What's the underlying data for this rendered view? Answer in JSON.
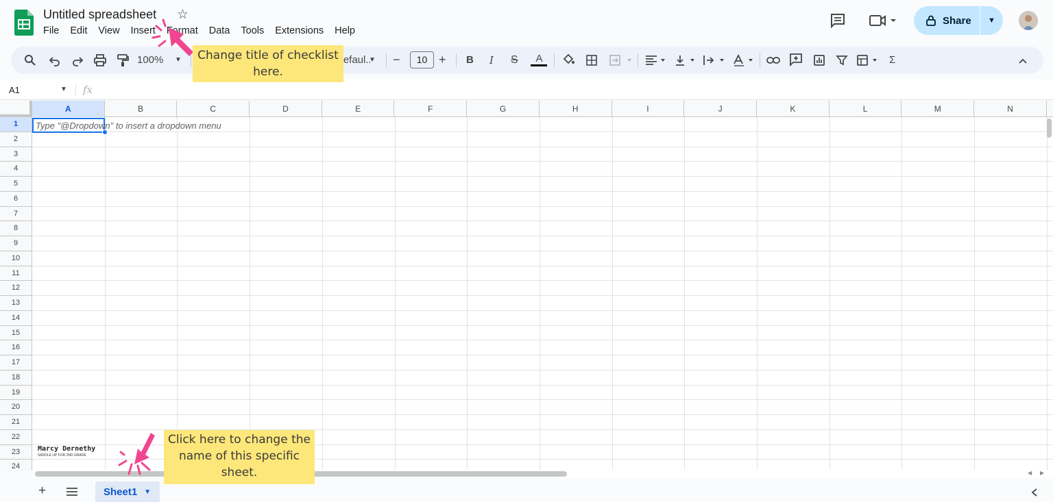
{
  "app": {
    "title": "Untitled spreadsheet",
    "menu": [
      "File",
      "Edit",
      "View",
      "Insert",
      "Format",
      "Data",
      "Tools",
      "Extensions",
      "Help"
    ],
    "share_label": "Share"
  },
  "toolbar": {
    "zoom": "100%",
    "font": "Defaul...",
    "font_size": "10",
    "bold": "B",
    "italic": "I",
    "text_color_letter": "A",
    "sum": "Σ"
  },
  "formula_bar": {
    "name_box": "A1",
    "fx_label": "fx"
  },
  "grid": {
    "columns": [
      "A",
      "B",
      "C",
      "D",
      "E",
      "F",
      "G",
      "H",
      "I",
      "J",
      "K",
      "L",
      "M",
      "N"
    ],
    "rows": [
      "1",
      "2",
      "3",
      "4",
      "5",
      "6",
      "7",
      "8",
      "9",
      "10",
      "11",
      "12",
      "13",
      "14",
      "15",
      "16",
      "17",
      "18",
      "19",
      "20",
      "21",
      "22",
      "23",
      "24"
    ],
    "selected_cell": "A1",
    "cell_hint": "Type \"@Dropdown\"  to insert a dropdown menu"
  },
  "sheets": {
    "tabs": [
      "Sheet1"
    ]
  },
  "annotations": {
    "title_callout": "Change title of checklist here.",
    "sheet_callout": "Click here to change the name of this specific sheet.",
    "watermark_line1": "Marcy Dernethy",
    "watermark_line2": "SADDLE UP FOR 2ND GRADE"
  },
  "colors": {
    "accent": "#1a73e8",
    "share_bg": "#c2e7ff",
    "logo": "#0f9d58",
    "callout": "#fde77a",
    "arrow": "#f0468f"
  }
}
